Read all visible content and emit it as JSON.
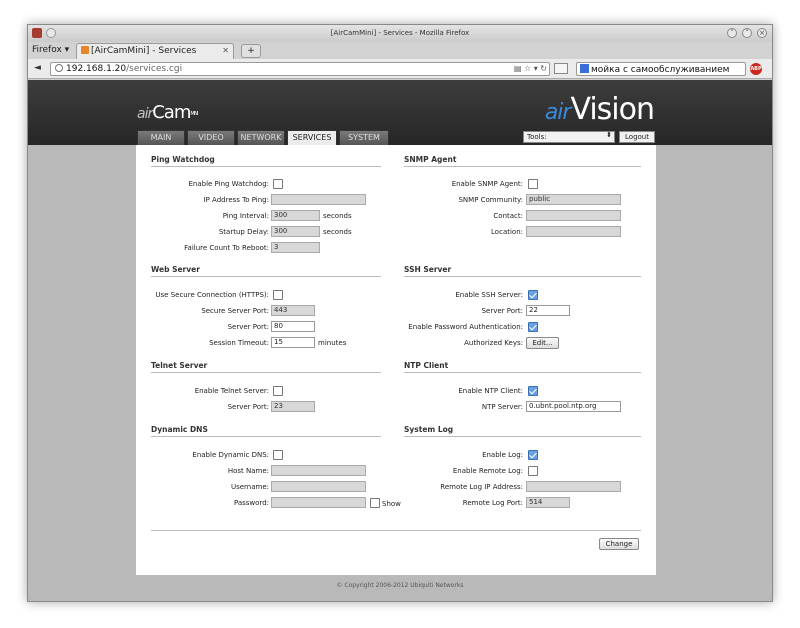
{
  "window": {
    "title": "[AirCamMini] - Services - Mozilla Firefox"
  },
  "browser": {
    "menu": "Firefox ▾",
    "tab_title": "[AirCamMini] - Services",
    "new_tab": "+",
    "back": "◄",
    "url_host": "192.168.1.20",
    "url_path": "/services.cgi",
    "url_icons": "▤ ☆ ▾ ↻",
    "search_text": "мойка с самообслуживанием",
    "abp": "ABP"
  },
  "brand": {
    "prefix": "air",
    "product": "Cam",
    "suffix": "MINI",
    "vendor_prefix": "air",
    "vendor": "Vision"
  },
  "nav": {
    "tabs": [
      {
        "label": "MAIN",
        "active": false
      },
      {
        "label": "VIDEO",
        "active": false
      },
      {
        "label": "NETWORK",
        "active": false
      },
      {
        "label": "SERVICES",
        "active": true
      },
      {
        "label": "SYSTEM",
        "active": false
      }
    ],
    "tools_label": "Tools:",
    "logout": "Logout"
  },
  "ping": {
    "title": "Ping Watchdog",
    "enable_label": "Enable Ping Watchdog:",
    "enable": false,
    "ip_label": "IP Address To Ping:",
    "ip": "",
    "interval_label": "Ping Interval:",
    "interval": "300",
    "interval_unit": "seconds",
    "delay_label": "Startup Delay:",
    "delay": "300",
    "delay_unit": "seconds",
    "failure_label": "Failure Count To Reboot:",
    "failure": "3"
  },
  "snmp": {
    "title": "SNMP Agent",
    "enable_label": "Enable SNMP Agent:",
    "enable": false,
    "community_label": "SNMP Community:",
    "community": "public",
    "contact_label": "Contact:",
    "contact": "",
    "location_label": "Location:",
    "location": ""
  },
  "web": {
    "title": "Web Server",
    "https_label": "Use Secure Connection (HTTPS):",
    "https": false,
    "secure_port_label": "Secure Server Port:",
    "secure_port": "443",
    "port_label": "Server Port:",
    "port": "80",
    "timeout_label": "Session Timeout:",
    "timeout": "15",
    "timeout_unit": "minutes"
  },
  "ssh": {
    "title": "SSH Server",
    "enable_label": "Enable SSH Server:",
    "enable": true,
    "port_label": "Server Port:",
    "port": "22",
    "pwauth_label": "Enable Password Authentication:",
    "pwauth": true,
    "keys_label": "Authorized Keys:",
    "keys_button": "Edit..."
  },
  "telnet": {
    "title": "Telnet Server",
    "enable_label": "Enable Telnet Server:",
    "enable": false,
    "port_label": "Server Port:",
    "port": "23"
  },
  "ntp": {
    "title": "NTP Client",
    "enable_label": "Enable NTP Client:",
    "enable": true,
    "server_label": "NTP Server:",
    "server": "0.ubnt.pool.ntp.org"
  },
  "ddns": {
    "title": "Dynamic DNS",
    "enable_label": "Enable Dynamic DNS:",
    "enable": false,
    "host_label": "Host Name:",
    "host": "",
    "user_label": "Username:",
    "user": "",
    "pass_label": "Password:",
    "pass": "",
    "show_label": "Show"
  },
  "syslog": {
    "title": "System Log",
    "enable_label": "Enable Log:",
    "enable": true,
    "remote_label": "Enable Remote Log:",
    "remote": false,
    "ip_label": "Remote Log IP Address:",
    "ip": "",
    "port_label": "Remote Log Port:",
    "port": "514"
  },
  "actions": {
    "change": "Change"
  },
  "footer": "© Copyright 2006-2012 Ubiquiti Networks"
}
